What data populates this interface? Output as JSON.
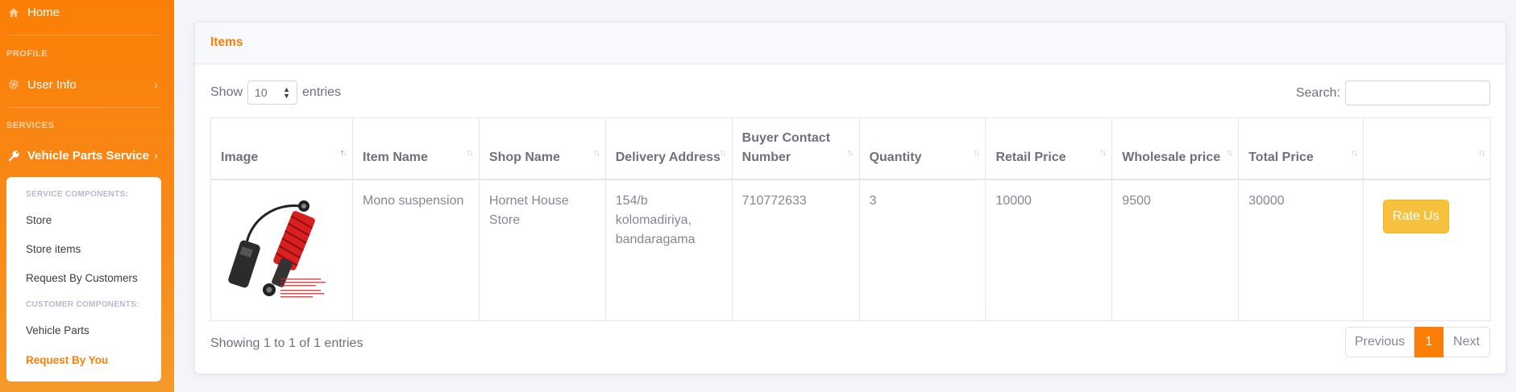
{
  "sidebar": {
    "home_label": "Home",
    "profile_heading": "PROFILE",
    "user_info_label": "User Info",
    "services_heading": "SERVICES",
    "vehicle_parts_label": "Vehicle Parts Service",
    "submenu": {
      "service_heading": "SERVICE COMPONENTS:",
      "store": "Store",
      "store_items": "Store items",
      "request_by_customers": "Request By Customers",
      "customer_heading": "CUSTOMER COMPONENTS:",
      "vehicle_parts": "Vehicle Parts",
      "request_by_you": "Request By You"
    }
  },
  "card": {
    "title": "Items",
    "show_label": "Show",
    "entries_label": "entries",
    "page_size": "10",
    "search_label": "Search:",
    "search_value": ""
  },
  "table": {
    "columns": [
      "Image",
      "Item Name",
      "Shop Name",
      "Delivery Address",
      "Buyer Contact Number",
      "Quantity",
      "Retail Price",
      "Wholesale price",
      "Total Price",
      ""
    ],
    "rows": [
      {
        "item_name": "Mono suspension",
        "shop_name": "Hornet House Store",
        "delivery_address": "154/b kolomadiriya, bandaragama",
        "buyer_contact": "710772633",
        "quantity": "3",
        "retail_price": "10000",
        "wholesale_price": "9500",
        "total_price": "30000",
        "action_label": "Rate Us"
      }
    ]
  },
  "footer": {
    "info": "Showing 1 to 1 of 1 entries",
    "previous": "Previous",
    "current_page": "1",
    "next": "Next"
  },
  "colors": {
    "accent": "#fb7f06",
    "rate_button": "#f6c23e"
  }
}
